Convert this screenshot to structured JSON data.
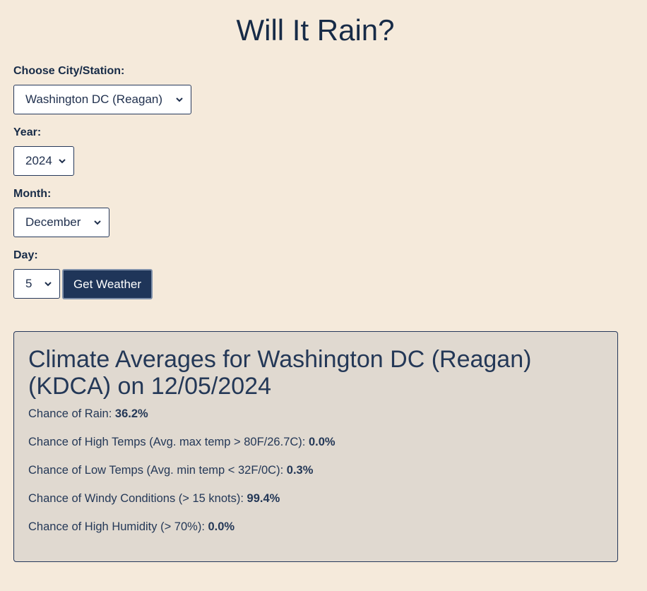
{
  "page": {
    "title": "Will It Rain?"
  },
  "form": {
    "city_label": "Choose City/Station:",
    "city_value": "Washington DC (Reagan)",
    "year_label": "Year:",
    "year_value": "2024",
    "month_label": "Month:",
    "month_value": "December",
    "day_label": "Day:",
    "day_value": "5",
    "submit_label": "Get Weather"
  },
  "results": {
    "heading": "Climate Averages for Washington DC (Reagan) (KDCA) on 12/05/2024",
    "stats": [
      {
        "label": "Chance of Rain: ",
        "value": "36.2%"
      },
      {
        "label": "Chance of High Temps (Avg. max temp > 80F/26.7C): ",
        "value": "0.0%"
      },
      {
        "label": "Chance of Low Temps (Avg. min temp < 32F/0C): ",
        "value": "0.3%"
      },
      {
        "label": "Chance of Windy Conditions (> 15 knots): ",
        "value": "99.4%"
      },
      {
        "label": "Chance of High Humidity (> 70%): ",
        "value": "0.0%"
      }
    ]
  },
  "colors": {
    "background": "#f5eadb",
    "panel_background": "#e0d9d0",
    "text": "#172b47",
    "button": "#1f3559"
  },
  "icons": {
    "select_arrow": "chevron-down-icon"
  }
}
